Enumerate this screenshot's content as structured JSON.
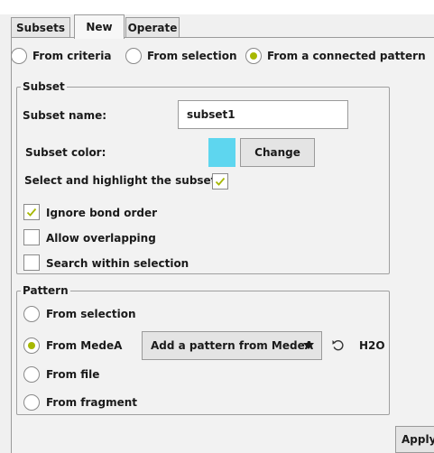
{
  "tabs": [
    {
      "label": "Subsets"
    },
    {
      "label": "New"
    },
    {
      "label": "Operate"
    }
  ],
  "source": {
    "options": [
      {
        "label": "From criteria",
        "selected": false
      },
      {
        "label": "From selection",
        "selected": false
      },
      {
        "label": "From a connected pattern",
        "selected": true
      }
    ]
  },
  "subset": {
    "legend": "Subset",
    "name_label": "Subset name:",
    "name_value": "subset1",
    "color_label": "Subset color:",
    "color_value": "#5ed6ef",
    "change_button": "Change",
    "select_highlight_label": "Select and highlight the subset:",
    "select_highlight_checked": true,
    "ignore_bond_order_label": "Ignore bond order",
    "ignore_bond_order_checked": true,
    "allow_overlapping_label": "Allow overlapping",
    "allow_overlapping_checked": false,
    "search_within_label": "Search within selection",
    "search_within_checked": false
  },
  "pattern": {
    "legend": "Pattern",
    "options": [
      {
        "label": "From selection",
        "selected": false
      },
      {
        "label": "From MedeA",
        "selected": true
      },
      {
        "label": "From file",
        "selected": false
      },
      {
        "label": "From fragment",
        "selected": false
      }
    ],
    "medea_dropdown": "Add a pattern from MedeA",
    "formula": "H2O"
  },
  "apply_button": "Apply",
  "colors": {
    "accent": "#a7b800",
    "swatch": "#5ed6ef"
  },
  "icons": [
    "chevron-down-icon",
    "reset-icon",
    "checkmark-icon"
  ]
}
